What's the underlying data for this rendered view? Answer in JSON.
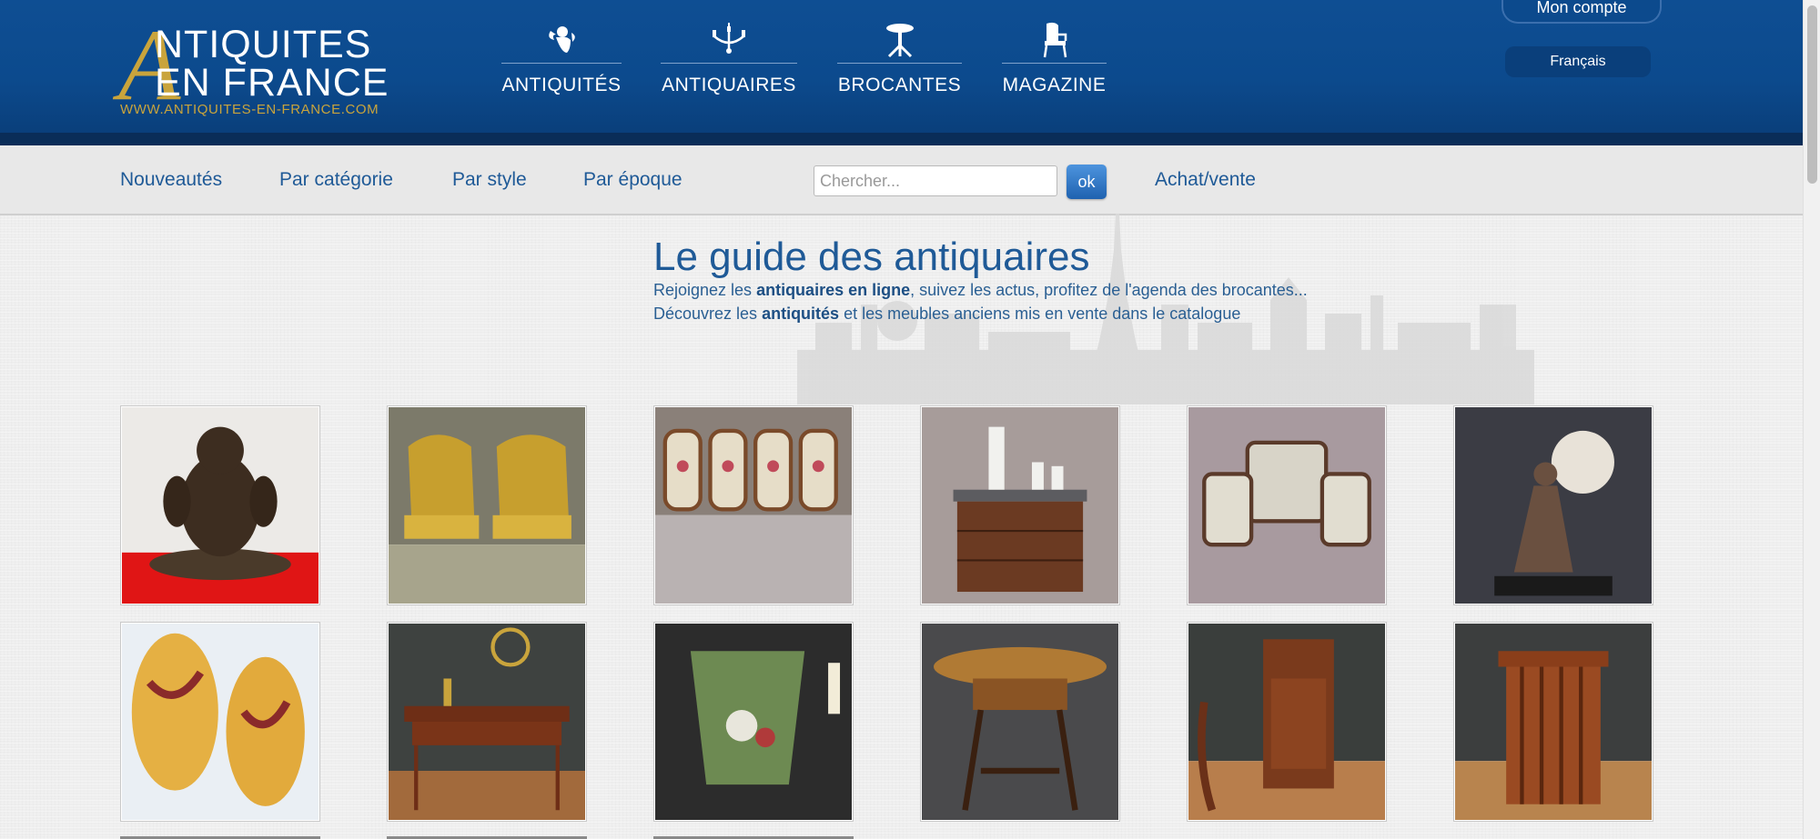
{
  "header": {
    "logo_line1": "NTIQUITES",
    "logo_line2": "EN FRANCE",
    "logo_url": "WWW.ANTIQUITES-EN-FRANCE.COM",
    "nav": [
      {
        "label": "ANTIQUITÉS",
        "icon": "cherub-icon"
      },
      {
        "label": "ANTIQUAIRES",
        "icon": "chandelier-icon"
      },
      {
        "label": "BROCANTES",
        "icon": "table-icon"
      },
      {
        "label": "MAGAZINE",
        "icon": "chair-icon"
      }
    ],
    "account_label": "Mon compte",
    "language_label": "Français"
  },
  "subnav": {
    "links": [
      "Nouveautés",
      "Par catégorie",
      "Par style",
      "Par époque"
    ],
    "search_placeholder": "Chercher...",
    "search_button": "ok",
    "buy_sell": "Achat/vente"
  },
  "hero": {
    "title": "Le guide des antiquaires",
    "line1": {
      "pre": "Rejoignez les ",
      "bold": "antiquaires en ligne",
      "post": ", suivez les actus, profitez de l'agenda des brocantes..."
    },
    "line2": {
      "pre": "Découvrez les ",
      "bold": "antiquités",
      "post": " et les meubles anciens mis en vente dans le catalogue"
    }
  },
  "products": [
    {
      "subject": "carved-bear-sculpture"
    },
    {
      "subject": "pair-of-gilt-bergere-armchairs"
    },
    {
      "subject": "set-of-four-floral-chairs"
    },
    {
      "subject": "marble-top-chest-with-figurines"
    },
    {
      "subject": "salon-set-sofa-and-armchairs"
    },
    {
      "subject": "bronze-lady-lamp"
    },
    {
      "subject": "pair-of-glass-wall-sconces"
    },
    {
      "subject": "writing-desk-with-lamp"
    },
    {
      "subject": "painted-tole-vase"
    },
    {
      "subject": "marquetry-side-table"
    },
    {
      "subject": "mahogany-pedestal-cabinet"
    },
    {
      "subject": "revolving-bookcase"
    }
  ],
  "colors": {
    "header_blue": "#0c4a8d",
    "gold": "#c9a43c",
    "link_blue": "#1f5a97"
  }
}
